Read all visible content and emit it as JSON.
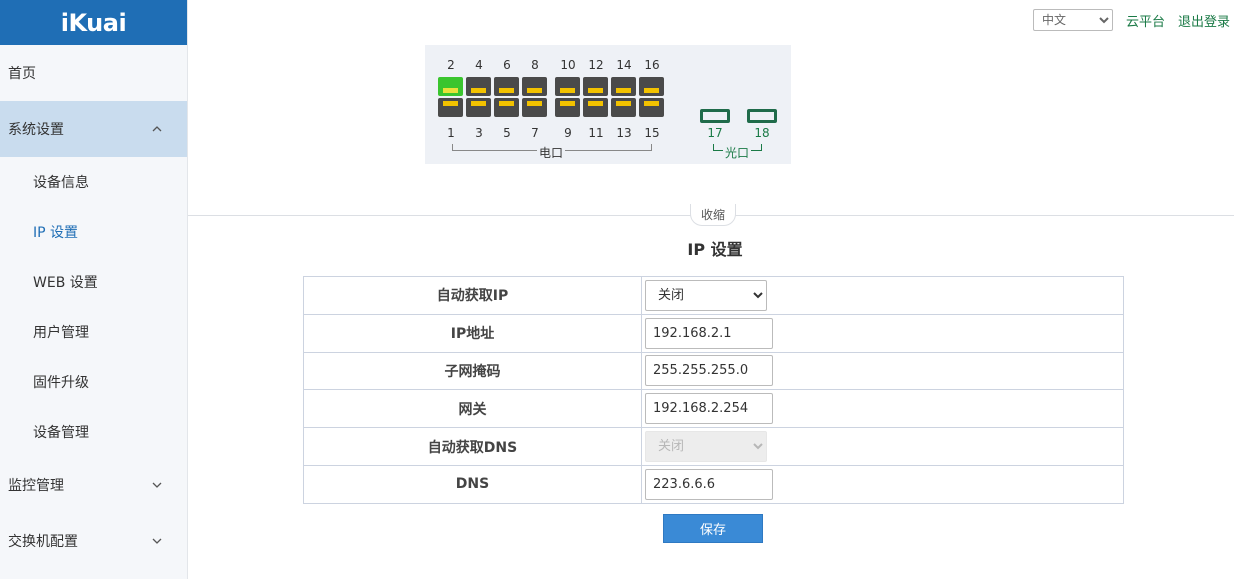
{
  "app": {
    "logo": "iKuai"
  },
  "sidebar": {
    "items": [
      {
        "label": "首页"
      },
      {
        "label": "系统设置",
        "expanded": true,
        "children": [
          {
            "label": "设备信息"
          },
          {
            "label": "IP 设置",
            "active": true
          },
          {
            "label": "WEB 设置"
          },
          {
            "label": "用户管理"
          },
          {
            "label": "固件升级"
          },
          {
            "label": "设备管理"
          }
        ]
      },
      {
        "label": "监控管理",
        "expanded": false
      },
      {
        "label": "交换机配置",
        "expanded": false
      }
    ]
  },
  "topbar": {
    "language": "中文",
    "cloud_link": "云平台",
    "logout_link": "退出登录"
  },
  "switch_panel": {
    "top_ports": [
      "2",
      "4",
      "6",
      "8",
      "10",
      "12",
      "14",
      "16"
    ],
    "bottom_ports": [
      "1",
      "3",
      "5",
      "7",
      "9",
      "11",
      "13",
      "15"
    ],
    "active_ports": [
      "2"
    ],
    "sfp_ports": [
      "17",
      "18"
    ],
    "electric_label": "电口",
    "optical_label": "光口"
  },
  "collapse_label": "收缩",
  "page_title": "IP 设置",
  "form": {
    "auto_ip_label": "自动获取IP",
    "auto_ip_value": "关闭",
    "ip_label": "IP地址",
    "ip_value": "192.168.2.1",
    "mask_label": "子网掩码",
    "mask_value": "255.255.255.0",
    "gateway_label": "网关",
    "gateway_value": "192.168.2.254",
    "auto_dns_label": "自动获取DNS",
    "auto_dns_value": "关闭",
    "dns_label": "DNS",
    "dns_value": "223.6.6.6",
    "save_label": "保存"
  },
  "colors": {
    "brand": "#1f6eb5",
    "link_green": "#1a7a46",
    "port_up": "#3ac52e",
    "save_button": "#3a8ad6"
  }
}
